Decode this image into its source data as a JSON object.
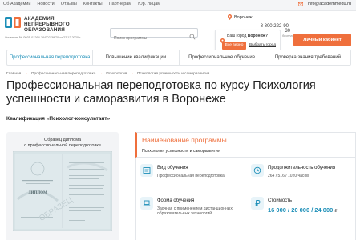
{
  "topbar": {
    "nav": [
      "Об Академии",
      "Новости",
      "Отзывы",
      "Контакты",
      "Партнерам",
      "Юр. лицам"
    ],
    "phone": "8 800 222-90-30",
    "email": "info@academmedu.ru"
  },
  "header": {
    "logo_lines": [
      "АКАДЕМИЯ",
      "НЕПРЕРЫВНОГО",
      "ОБРАЗОВАНИЯ"
    ],
    "license": "Лицензия № Л035-01264-36/00279670 от 22.12.2020 г.",
    "search_placeholder": "Поиск программы",
    "city": "Воронеж",
    "city_question": "Ваш город",
    "city_name": "Воронеж?",
    "city_yes": "Все верно",
    "city_other": "Выбрать город",
    "phone_note": "Звонок по России бесплатный",
    "cta": "Личный кабинет"
  },
  "mainnav": [
    "Профессиональная переподготовка",
    "Повышение квалификации",
    "Профессиональное обучение",
    "Проверка знания требований"
  ],
  "breadcrumbs": [
    "Главная",
    "Профессиональная переподготовка",
    "Психология",
    "Психология успешности и саморазвития"
  ],
  "title": "Профессиональная переподготовка по курсу Психология успешности и саморазвития в Воронеже",
  "qualification": "Квалификация «Психолог-консультант»",
  "diploma": {
    "caption_line1": "Образец диплома",
    "caption_line2": "о профессиональной переподготовке",
    "doc_word": "ДИПЛОМ",
    "watermark": "ОБРАЗЕЦ"
  },
  "program": {
    "label": "Наименование программы",
    "name": "Психология успешности и саморазвития"
  },
  "details": {
    "type_h": "Вид обучения",
    "type_v": "Профессиональная переподготовка",
    "duration_h": "Продолжительность обучения",
    "duration_v": "264 / 516 / 1020 часов",
    "form_h": "Форма обучения",
    "form_v": "Заочная с применением дистанционных образовательных технологий",
    "cost_h": "Стоимость",
    "cost_v": "16 000 / 20 000 / 24 000",
    "cost_unit": "₽"
  },
  "colors": {
    "accent": "#ef6f3c",
    "link": "#1d8fb8"
  }
}
